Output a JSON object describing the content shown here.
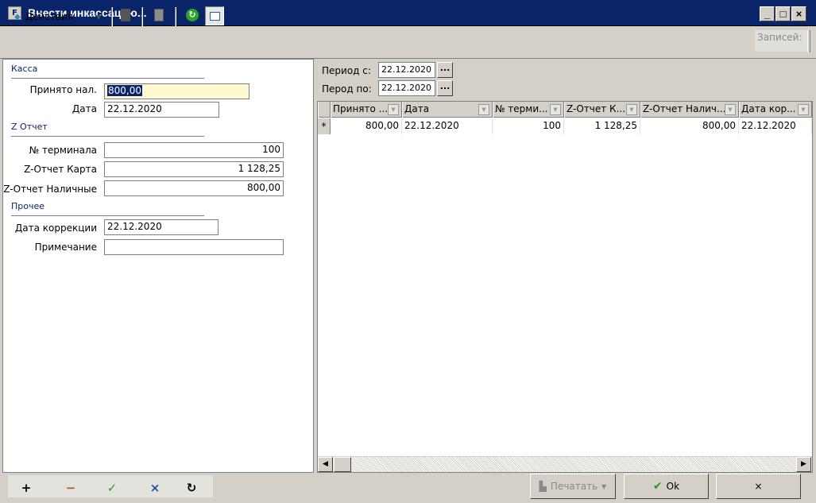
{
  "window": {
    "title": "Внести инкассацию...",
    "app_icon": "form-icon",
    "controls": {
      "minimize": "_",
      "maximize": "□",
      "close": "×"
    }
  },
  "toolbar": {
    "actions_label": "Действия",
    "records_label": "Записей:",
    "icons": [
      "diamond-icon",
      "document-icon",
      "list-icon",
      "refresh-icon",
      "panel-view-icon"
    ]
  },
  "left_panel": {
    "kassa": {
      "title": "Касса",
      "accepted_label": "Принято нал.",
      "accepted_value": "800,00",
      "date_label": "Дата",
      "date_value": "22.12.2020"
    },
    "z_report": {
      "title": "Z Отчет",
      "terminal_label": "№ терминала",
      "terminal_value": "100",
      "card_label": "Z-Отчет Карта",
      "card_value": "1 128,25",
      "cash_label": "Z-Отчет Наличные",
      "cash_value": "800,00"
    },
    "other": {
      "title": "Прочее",
      "correction_date_label": "Дата коррекции",
      "correction_date_value": "22.12.2020",
      "note_label": "Примечание",
      "note_value": ""
    }
  },
  "period": {
    "from_label": "Период с:",
    "from_value": "22.12.2020",
    "to_label": "Перод по:",
    "to_value": "22.12.2020",
    "picker_label": "..."
  },
  "grid": {
    "columns": [
      "Принято ...",
      "Дата",
      "№ терми...",
      "Z-Отчет К...",
      "Z-Отчет Налич...",
      "Дата кор..."
    ],
    "row_indicator": "*",
    "rows": [
      [
        "800,00",
        "22.12.2020",
        "100",
        "1 128,25",
        "800,00",
        "22.12.2020"
      ]
    ]
  },
  "bottom": {
    "left_buttons": {
      "add": "+",
      "remove": "−",
      "confirm": "✓",
      "cancel": "×",
      "refresh": "↻"
    },
    "print_label": "Печатать",
    "ok_label": "Ok",
    "cancel_label": "×"
  }
}
